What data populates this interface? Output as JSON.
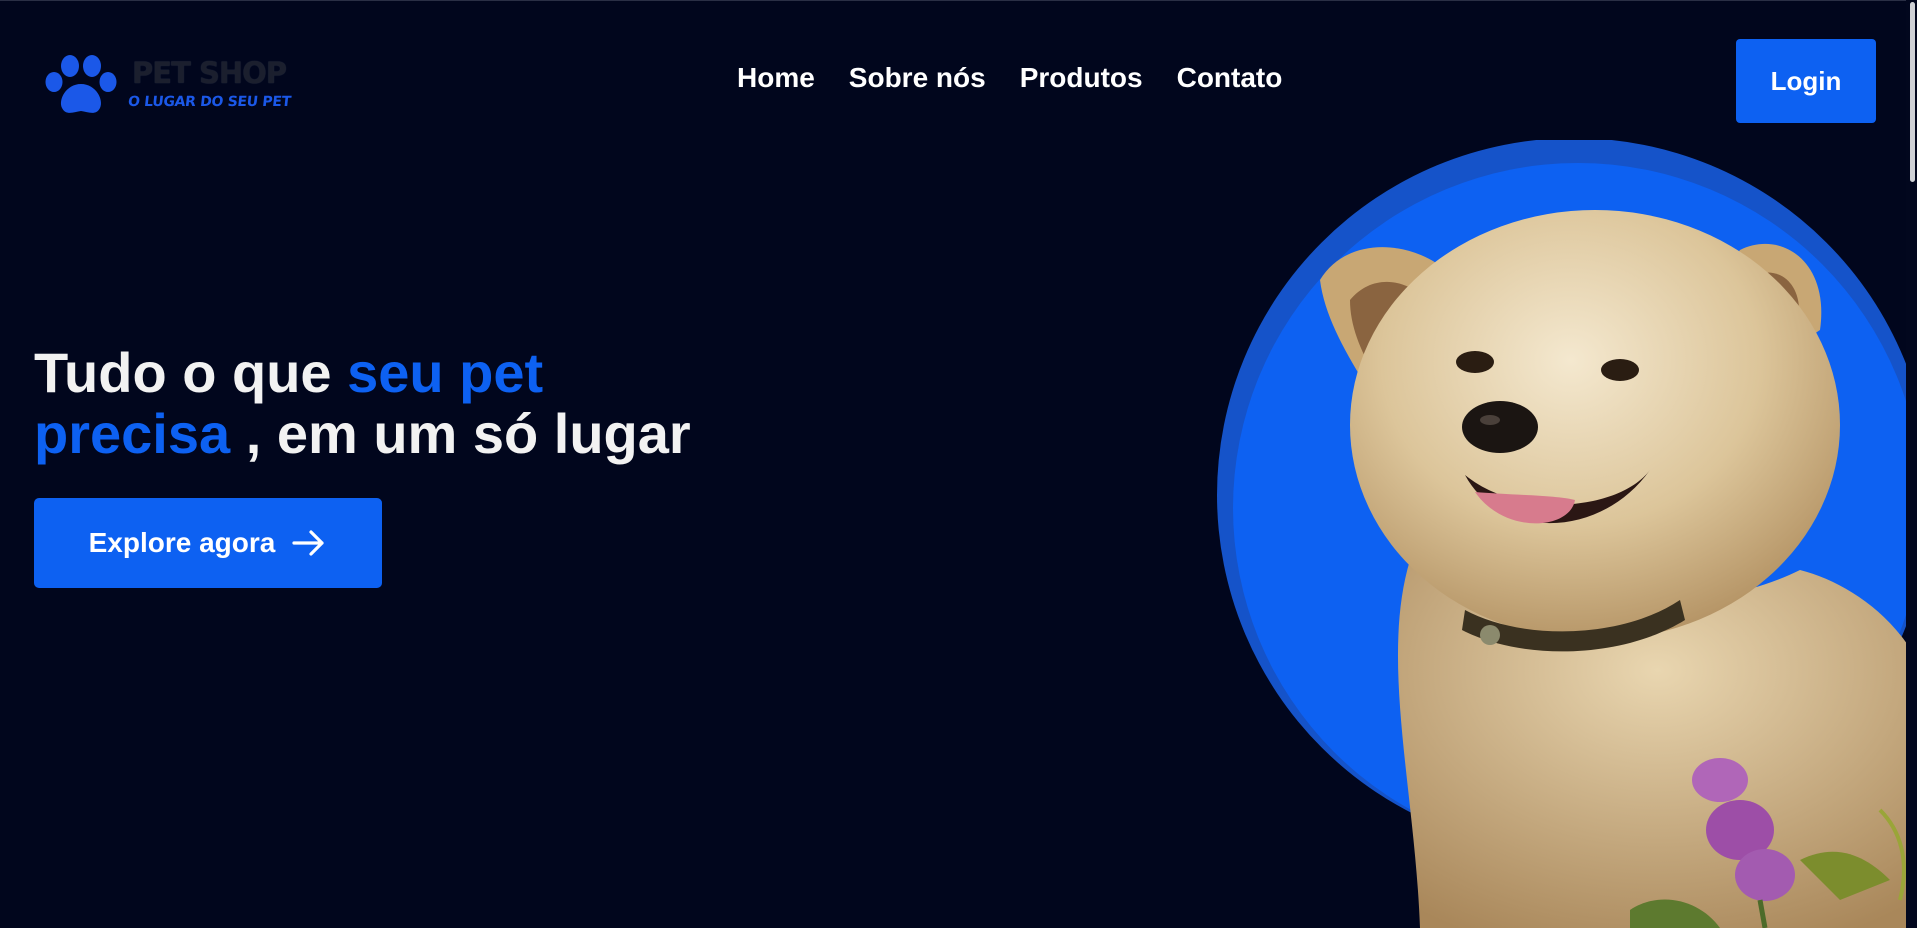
{
  "colors": {
    "background": "#01061d",
    "accent": "#0d61f2",
    "text": "#f2f2f2"
  },
  "logo": {
    "title": "PET SHOP",
    "tagline": "O LUGAR DO SEU PET",
    "icon": "paw-icon"
  },
  "nav": {
    "items": [
      {
        "label": "Home"
      },
      {
        "label": "Sobre nós"
      },
      {
        "label": "Produtos"
      },
      {
        "label": "Contato"
      }
    ]
  },
  "header": {
    "login_label": "Login"
  },
  "hero": {
    "title_part1": "Tudo o que ",
    "title_highlight1": "seu pet",
    "title_highlight2": "precisa",
    "title_part2": " , em um só lugar",
    "cta_label": "Explore agora",
    "cta_icon": "arrow-right-icon",
    "image_subject": "dog-photo"
  }
}
